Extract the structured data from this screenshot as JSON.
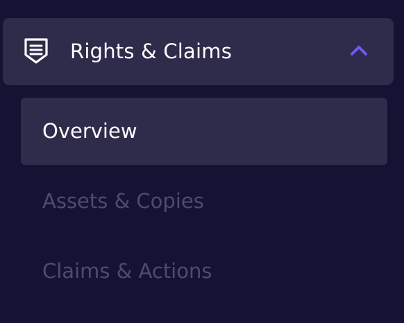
{
  "nav": {
    "group": {
      "label": "Rights & Claims",
      "icon": "shield-list-icon",
      "expanded": true,
      "chevron_icon": "chevron-up-icon",
      "chevron_color": "#6b5cf6"
    },
    "items": [
      {
        "label": "Overview",
        "active": true
      },
      {
        "label": "Assets & Copies",
        "active": false
      },
      {
        "label": "Claims & Actions",
        "active": false
      }
    ]
  },
  "colors": {
    "background": "#141333",
    "active_bg": "#2f2b4a",
    "active_text": "#ffffff",
    "inactive_text": "#4d4c6c",
    "accent": "#6b5cf6"
  }
}
